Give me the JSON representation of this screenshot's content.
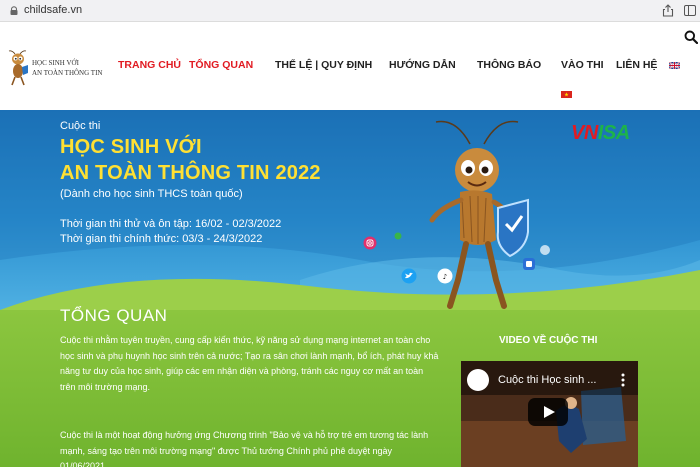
{
  "browser": {
    "url": "childsafe.vn"
  },
  "header": {
    "logo": {
      "line1": "HỌC SINH VỚI",
      "line2": "AN TOÀN THÔNG TIN"
    },
    "nav": [
      {
        "label": "TRANG CHỦ",
        "active": true
      },
      {
        "label": "TỔNG QUAN",
        "active": true
      },
      {
        "label": "THỂ LỆ | QUY ĐỊNH",
        "active": false
      },
      {
        "label": "HƯỚNG DẪN",
        "active": false
      },
      {
        "label": "THÔNG BÁO",
        "active": false
      },
      {
        "label": "VÀO THI",
        "active": false
      },
      {
        "label": "LIÊN HỆ",
        "active": false
      }
    ],
    "languages": [
      "English",
      "Tiếng Việt"
    ]
  },
  "hero": {
    "label": "Cuộc thi",
    "title_line1": "HỌC SINH VỚI",
    "title_line2": "AN TOÀN THÔNG TIN 2022",
    "subtitle": "(Dành cho học sinh THCS toàn quốc)",
    "date_trial": "Thời gian thi thử và ôn tập: 16/02 - 02/3/2022",
    "date_official": "Thời gian thi chính thức: 03/3 - 24/3/2022",
    "brand": {
      "vn": "VN",
      "isa": "ISA"
    }
  },
  "overview": {
    "title": "TỔNG QUAN",
    "paragraph1": "Cuộc thi nhằm tuyên truyền, cung cấp kiến thức, kỹ năng sử dụng mạng internet an toàn cho học sinh và phụ huynh học sinh trên cả nước; Tạo ra sân chơi lành mạnh, bổ ích, phát huy khả năng tư duy của học sinh, giúp các em nhận diện và phòng, tránh các nguy cơ mất an toàn trên môi trường mạng.",
    "paragraph2": "Cuộc thi là một hoạt động hưởng ứng Chương trình \"Bảo vệ và hỗ trợ trẻ em tương tác lành mạnh, sáng tạo trên môi trường mạng\" được Thủ tướng Chính phủ phê duyệt ngày 01/06/2021."
  },
  "video": {
    "heading": "VIDEO VỀ CUỘC THI",
    "caption": "Cuộc thi Học sinh ..."
  },
  "colors": {
    "accent_red": "#e11b22",
    "title_yellow": "#ffe033",
    "hero_blue": "#1b6fb5",
    "grass_green": "#8cc63f"
  }
}
